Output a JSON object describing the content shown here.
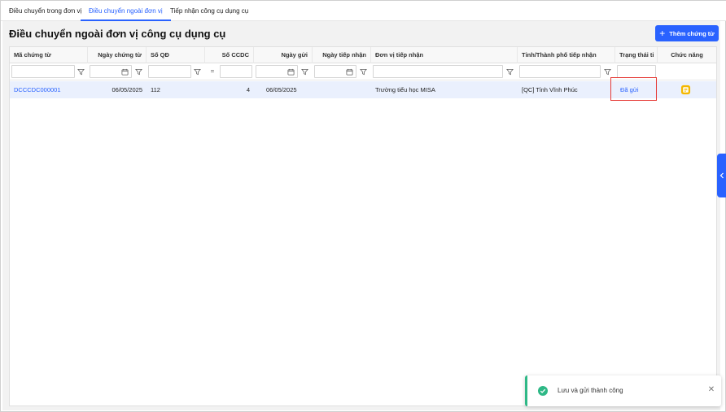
{
  "tabs": [
    {
      "label": "Điều chuyển trong đơn vị",
      "active": false
    },
    {
      "label": "Điều chuyển ngoài đơn vị",
      "active": true
    },
    {
      "label": "Tiếp nhận công cụ dụng cụ",
      "active": false
    }
  ],
  "page": {
    "title": "Điều chuyển ngoài đơn vị công cụ dụng cụ",
    "add_button_label": "Thêm chứng từ"
  },
  "table": {
    "columns": [
      "Mã chứng từ",
      "Ngày chứng từ",
      "Số QĐ",
      "Số CCDC",
      "Ngày gửi",
      "Ngày tiếp nhận",
      "Đơn vị tiếp nhận",
      "Tỉnh/Thành phố tiếp nhận",
      "Trạng thái ti",
      "Chức năng"
    ],
    "filter_operator_number": "=",
    "rows": [
      {
        "code": "DCCCDC000001",
        "doc_date": "06/05/2025",
        "decision_no": "112",
        "tool_count": "4",
        "sent_date": "06/05/2025",
        "received_date": "",
        "receiving_unit": "Trường tiểu học MISA",
        "province": "[QC] Tỉnh Vĩnh Phúc",
        "status": "Đã gửi"
      }
    ]
  },
  "toast": {
    "message": "Lưu và gửi thành công",
    "type": "success"
  },
  "colors": {
    "accent": "#2962ff",
    "success": "#2eb886",
    "highlight": "#e53935",
    "selected_row": "#eaf0fd",
    "action_icon": "#f5b800"
  }
}
